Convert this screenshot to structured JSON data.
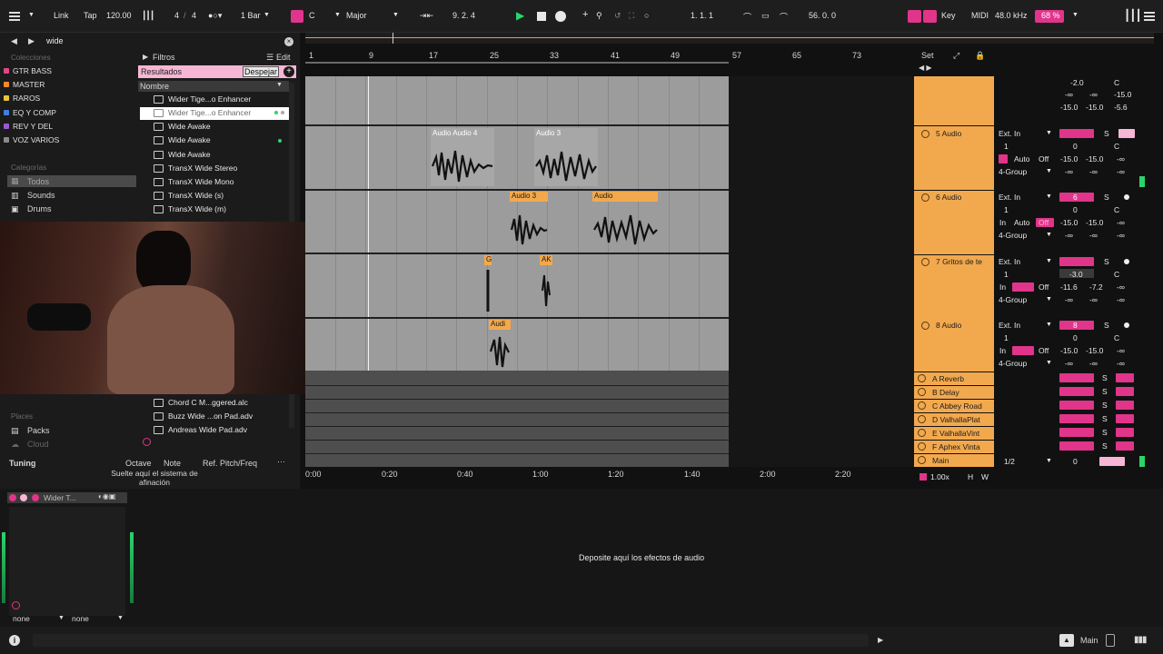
{
  "topbar": {
    "link": "Link",
    "tap": "Tap",
    "tempo": "120.00",
    "signature_num": "4",
    "signature_den": "4",
    "quantize": "1 Bar",
    "key_root": "C",
    "key_scale": "Major",
    "position": "9.  2.  4",
    "loop_start": "1.  1.  1",
    "loop_length": "56.  0.  0",
    "key_label": "Key",
    "midi_label": "MIDI",
    "sample_rate": "48.0 kHz",
    "cpu": "68 %"
  },
  "browser": {
    "search_value": "wide",
    "collections_title": "Colecciones",
    "collections": [
      {
        "label": "GTR BASS",
        "color": "#e0478a"
      },
      {
        "label": "MASTER",
        "color": "#f08a2a"
      },
      {
        "label": "RAROS",
        "color": "#e6c53a"
      },
      {
        "label": "EQ Y COMP",
        "color": "#3f7fe0"
      },
      {
        "label": "REV Y DEL",
        "color": "#9b59d0"
      },
      {
        "label": "VOZ VARIOS",
        "color": "#8a8a8a"
      }
    ],
    "categories_title": "Categorías",
    "categories": [
      "Todos",
      "Sounds",
      "Drums"
    ],
    "places_title": "Places",
    "places": [
      "Packs",
      "Cloud"
    ],
    "filters_label": "Filtros",
    "edit_label": "Edit",
    "results_label": "Resultados",
    "clear_label": "Despejar",
    "name_header": "Nombre",
    "results": [
      "Wider Tige...o Enhancer",
      "Wider Tige...o Enhancer",
      "Wide Awake",
      "Wide Awake",
      "Wide Awake",
      "TransX Wide Stereo",
      "TransX Wide Mono",
      "TransX Wide (s)",
      "TransX Wide (m)",
      "Chord C M...ggered.alc",
      "Buzz Wide ...on Pad.adv",
      "Andreas Wide Pad.adv"
    ]
  },
  "tuning": {
    "title": "Tuning",
    "col_octave": "Octave",
    "col_note": "Note",
    "col_ref": "Ref. Pitch/Freq",
    "drop_text": "Suelte aquí el sistema de afinación"
  },
  "ruler": {
    "bars": [
      "1",
      "9",
      "17",
      "25",
      "33",
      "41",
      "49",
      "57",
      "65",
      "73"
    ],
    "times": [
      "0:00",
      "0:20",
      "0:40",
      "1:00",
      "1:20",
      "1:40",
      "2:00",
      "2:20"
    ],
    "set_label": "Set"
  },
  "clips": [
    {
      "label": "Audio Audio 4"
    },
    {
      "label": "Audio 3"
    },
    {
      "label": "Audio 3"
    },
    {
      "label": "Audio"
    },
    {
      "label": "G"
    },
    {
      "label": "AK"
    },
    {
      "label": "Audi"
    }
  ],
  "tracks": [
    {
      "name": "5 Audio",
      "input": "Ext. In",
      "channel": "1",
      "number": "0",
      "volume": "-15.0",
      "pan": "-15.0",
      "group": "4-Group",
      "monitor_auto": "Auto",
      "monitor_off": "Off"
    },
    {
      "name": "6 Audio",
      "input": "Ext. In",
      "channel": "1",
      "number": "6",
      "volume": "-15.0",
      "pan": "-15.0",
      "group": "4-Group",
      "monitor_in": "In",
      "monitor_auto": "Auto",
      "monitor_off": "Off"
    },
    {
      "name": "7 Gritos de te",
      "input": "Ext. In",
      "channel": "1",
      "number": "-3.0",
      "volume": "-11.6",
      "pan": "-7.2",
      "group": "4-Group",
      "monitor_in": "In",
      "monitor_off": "Off"
    },
    {
      "name": "8 Audio",
      "input": "Ext. In",
      "channel": "1",
      "number": "8",
      "volume": "-15.0",
      "pan": "-15.0",
      "group": "4-Group",
      "monitor_in": "In",
      "monitor_off": "Off"
    }
  ],
  "top_track": {
    "vol": "-2.0",
    "pan": "C",
    "a": "-15.0",
    "b": "-15.0",
    "c": "-5.6",
    "inf1": "-∞",
    "inf2": "-∞",
    "vol2": "-15.0",
    "vol3": "-15.0"
  },
  "returns": [
    {
      "name": "A Reverb"
    },
    {
      "name": "B Delay"
    },
    {
      "name": "C Abbey Road"
    },
    {
      "name": "D ValhallaPlat"
    },
    {
      "name": "E ValhallaVint"
    },
    {
      "name": "F Aphex Vinta"
    }
  ],
  "main_track": {
    "name": "Main",
    "routing": "1/2",
    "number": "0",
    "zoom": "1.00x",
    "h": "H",
    "w": "W"
  },
  "solo": "S",
  "pan_center": "C",
  "neg_inf": "-∞",
  "device": {
    "name": "Wider T...",
    "dropdown1": "none",
    "dropdown2": "none",
    "drop_effects": "Deposite aquí los efectos de audio"
  },
  "status": {
    "main_label": "Main"
  }
}
